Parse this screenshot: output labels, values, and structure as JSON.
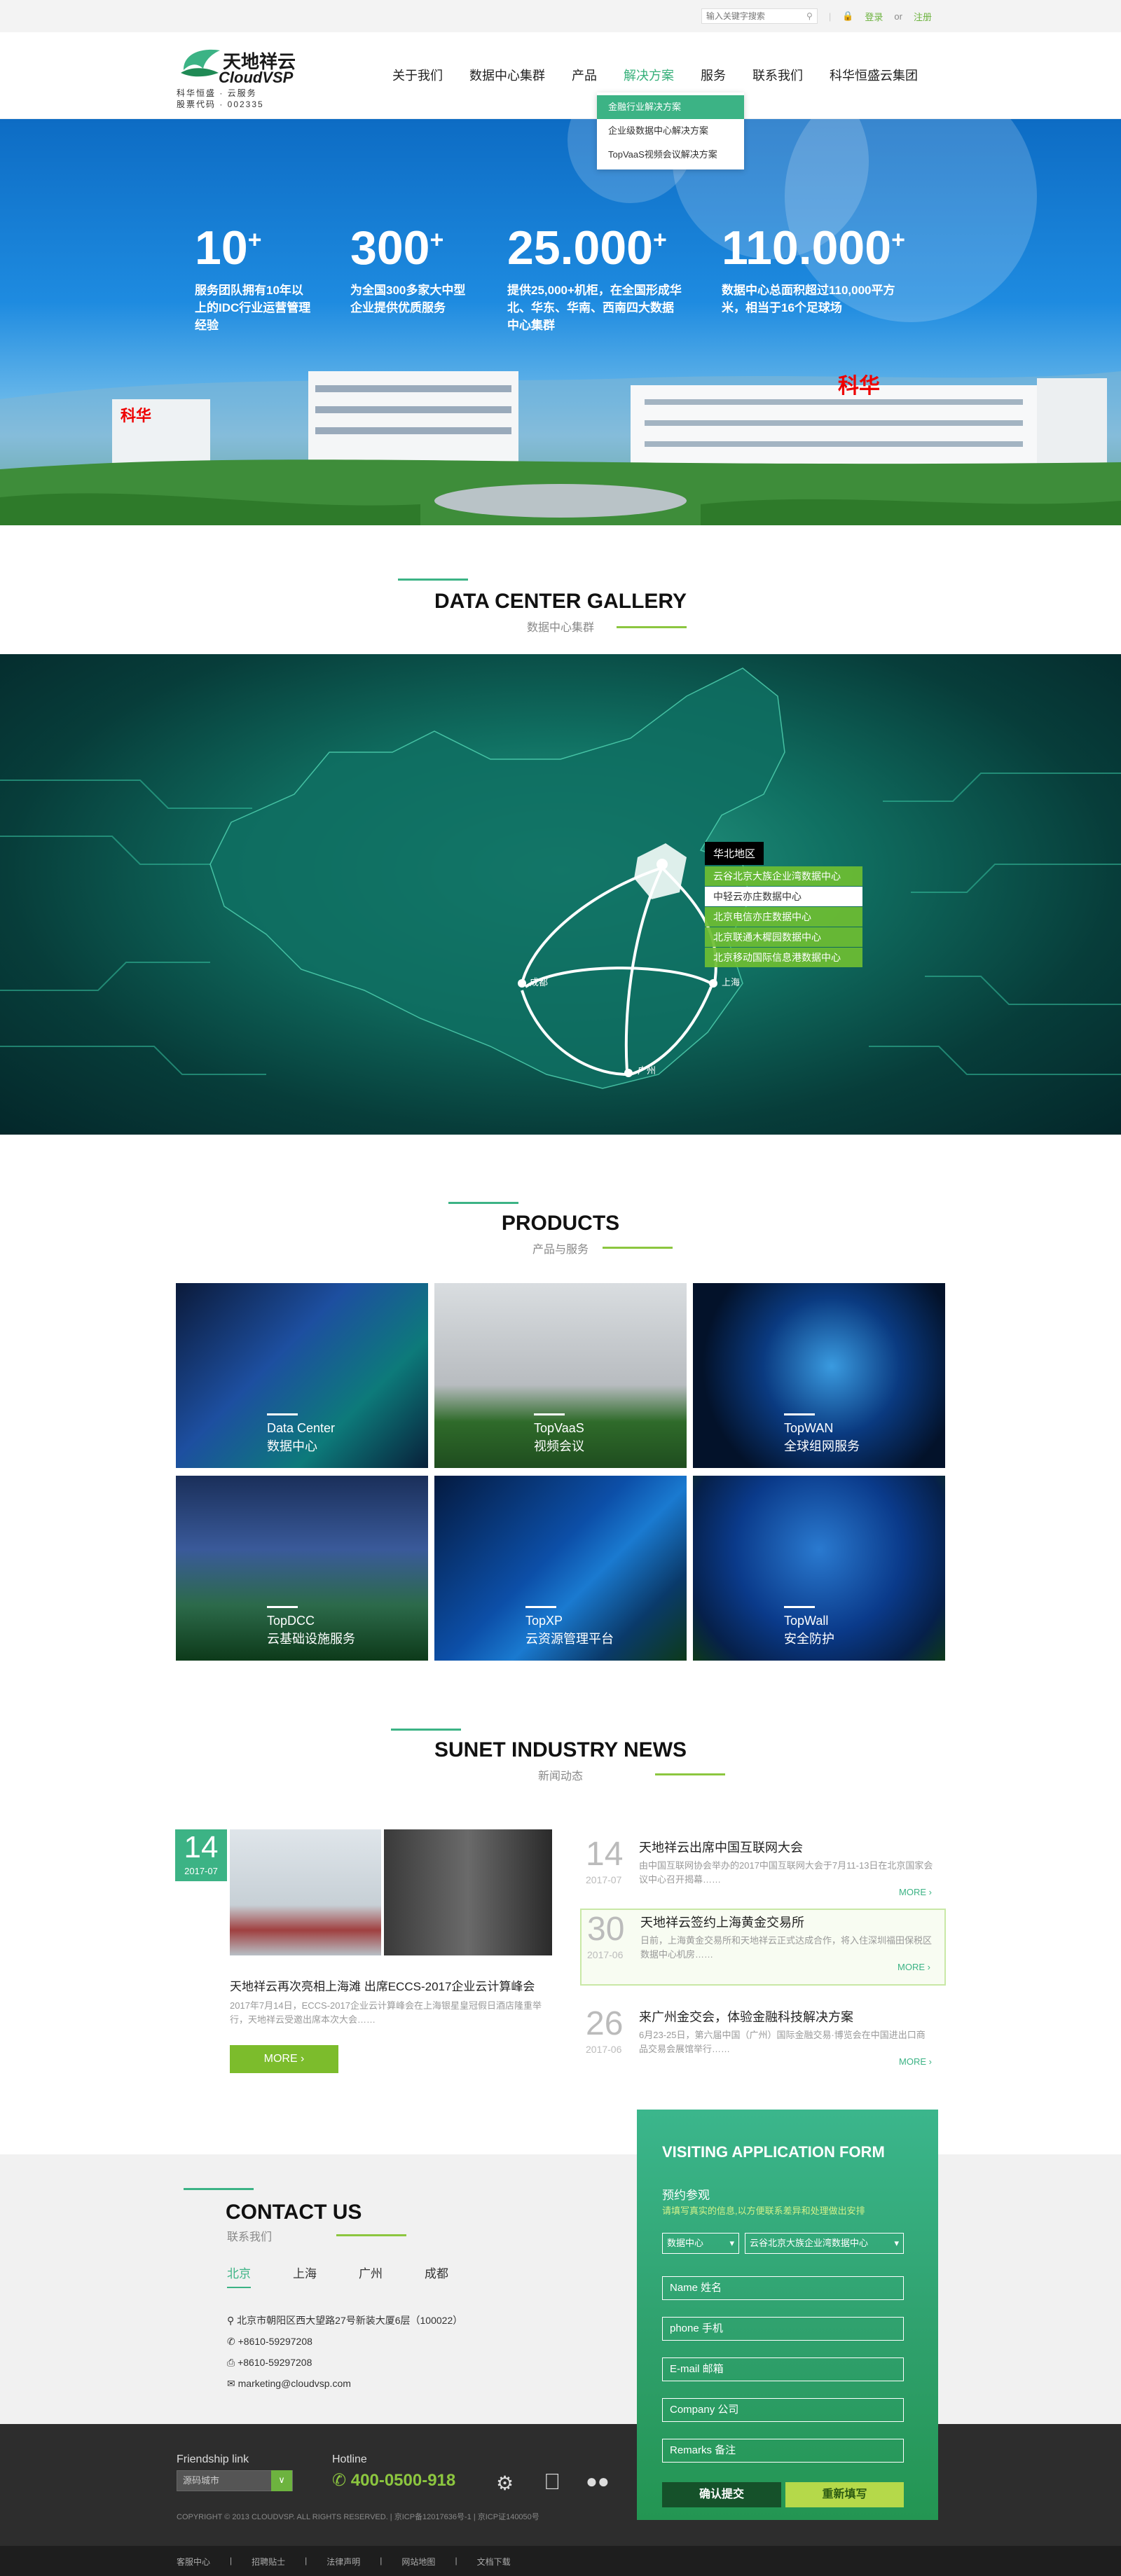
{
  "topbar": {
    "search_placeholder": "输入关键字搜索",
    "login": "登录",
    "or": "or",
    "register": "注册"
  },
  "logo": {
    "name": "天地祥云",
    "brand": "CloudVSP",
    "line1": "科华恒盛 · 云服务",
    "line2": "股票代码 · 002335"
  },
  "nav": {
    "items": [
      "关于我们",
      "数据中心集群",
      "产品",
      "解决方案",
      "服务",
      "联系我们",
      "科华恒盛云集团"
    ],
    "active": "解决方案"
  },
  "dropdown": {
    "items": [
      "金融行业解决方案",
      "企业级数据中心解决方案",
      "TopVaaS视频会议解决方案"
    ],
    "active": "金融行业解决方案"
  },
  "hero": {
    "stats": [
      {
        "value": "10",
        "sup": "+",
        "desc": "服务团队拥有10年以上的IDC行业运营管理经验"
      },
      {
        "value": "300",
        "sup": "+",
        "desc": "为全国300多家大中型企业提供优质服务"
      },
      {
        "value": "25.000",
        "sup": "+",
        "desc": "提供25,000+机柜，在全国形成华北、华东、华南、西南四大数据中心集群"
      },
      {
        "value": "110.000",
        "sup": "+",
        "desc": "数据中心总面积超过110,000平方米，相当于16个足球场"
      }
    ],
    "sign_left": "科华",
    "sign_right": "科华"
  },
  "gallery": {
    "title": "DATA CENTER GALLERY",
    "subtitle": "数据中心集群"
  },
  "map": {
    "region": "华北地区",
    "centers": [
      "云谷北京大族企业湾数据中心",
      "中轻云亦庄数据中心",
      "北京电信亦庄数据中心",
      "北京联通木樨园数据中心",
      "北京移动国际信息港数据中心"
    ],
    "selected": "中轻云亦庄数据中心",
    "cities": [
      "成都",
      "上海",
      "广州"
    ]
  },
  "products": {
    "title": "PRODUCTS",
    "subtitle": "产品与服务",
    "items": [
      {
        "en": "Data Center",
        "cn": "数据中心"
      },
      {
        "en": "TopVaaS",
        "cn": "视频会议"
      },
      {
        "en": "TopWAN",
        "cn": "全球组网服务"
      },
      {
        "en": "TopDCC",
        "cn": "云基础设施服务"
      },
      {
        "en": "TopXP",
        "cn": "云资源管理平台"
      },
      {
        "en": "TopWall",
        "cn": "安全防护"
      }
    ]
  },
  "news": {
    "title": "SUNET INDUSTRY NEWS",
    "subtitle": "新闻动态",
    "feature": {
      "day": "14",
      "ym": "2017-07",
      "title": "天地祥云再次亮相上海滩 出席ECCS-2017企业云计算峰会",
      "summary": "2017年7月14日，ECCS-2017企业云计算峰会在上海银星皇冠假日酒店隆重举行，天地祥云受邀出席本次大会……",
      "more": "MORE"
    },
    "items": [
      {
        "day": "14",
        "ym": "2017-07",
        "title": "天地祥云出席中国互联网大会",
        "summary": "由中国互联网协会举办的2017中国互联网大会于7月11-13日在北京国家会议中心召开揭幕……",
        "more": "MORE"
      },
      {
        "day": "30",
        "ym": "2017-06",
        "title": "天地祥云签约上海黄金交易所",
        "summary": "日前，上海黄金交易所和天地祥云正式达成合作，将入住深圳福田保税区数据中心机房……",
        "more": "MORE"
      },
      {
        "day": "26",
        "ym": "2017-06",
        "title": "来广州金交会，体验金融科技解决方案",
        "summary": "6月23-25日，第六届中国（广州）国际金融交易·博览会在中国进出口商品交易会展馆举行……",
        "more": "MORE"
      }
    ]
  },
  "contact": {
    "title": "CONTACT US",
    "subtitle": "联系我们",
    "cities": [
      "北京",
      "上海",
      "广州",
      "成都"
    ],
    "active_city": "北京",
    "address": "北京市朝阳区西大望路27号新装大厦6层（100022）",
    "phone": "+8610-59297208",
    "fax": "+8610-59297208",
    "email": "marketing@cloudvsp.com"
  },
  "form": {
    "title": "VISITING APPLICATION FORM",
    "subtitle": "预约参观",
    "hint": "请填写真实的信息,以方便联系差异和处理做出安排",
    "select1": "数据中心",
    "select2": "云谷北京大族企业湾数据中心",
    "fields": [
      "Name 姓名",
      "phone 手机",
      "E-mail 邮箱",
      "Company 公司",
      "Remarks 备注"
    ],
    "submit": "确认提交",
    "reset": "重新填写"
  },
  "footer": {
    "friendship": "Friendship link",
    "friend_select": "源码城市",
    "hotline_label": "Hotline",
    "hotline": "400-0500-918",
    "copyright": "COPYRIGHT © 2013 CLOUDVSP. ALL RIGHTS RESERVED. | 京ICP备12017636号-1 | 京ICP证140050号",
    "links": [
      "客服中心",
      "招聘贴士",
      "法律声明",
      "网站地图",
      "文档下载"
    ]
  },
  "colors": {
    "accent": "#3cb385",
    "green": "#8cc63f",
    "dark": "#2d2d2d"
  }
}
